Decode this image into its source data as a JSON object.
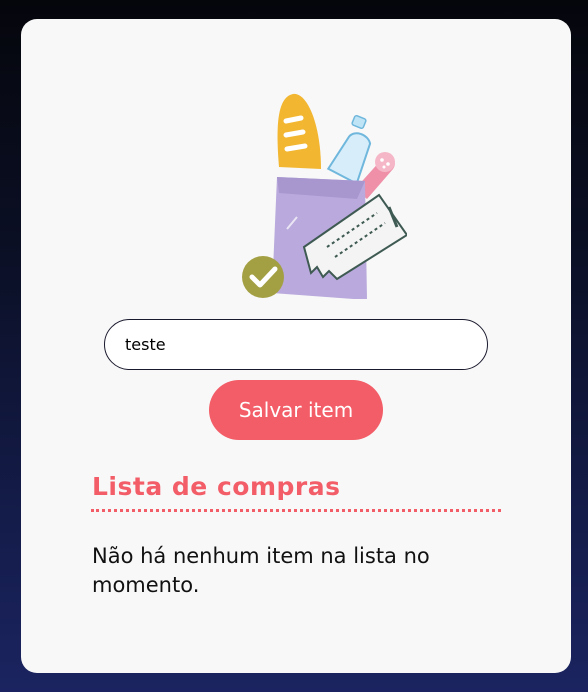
{
  "form": {
    "item_value": "teste",
    "save_label": "Salvar item"
  },
  "list": {
    "title": "Lista de compras",
    "empty_message": "Não há nenhum item na lista no momento."
  },
  "illustration": {
    "icon": "grocery-bag-icon",
    "check_icon": "check-circle-icon"
  },
  "colors": {
    "accent": "#f35d67",
    "card_bg": "#f8f8f8",
    "bag": "#b9a9dc",
    "bread": "#f2b630",
    "check_badge": "#a3a044"
  }
}
